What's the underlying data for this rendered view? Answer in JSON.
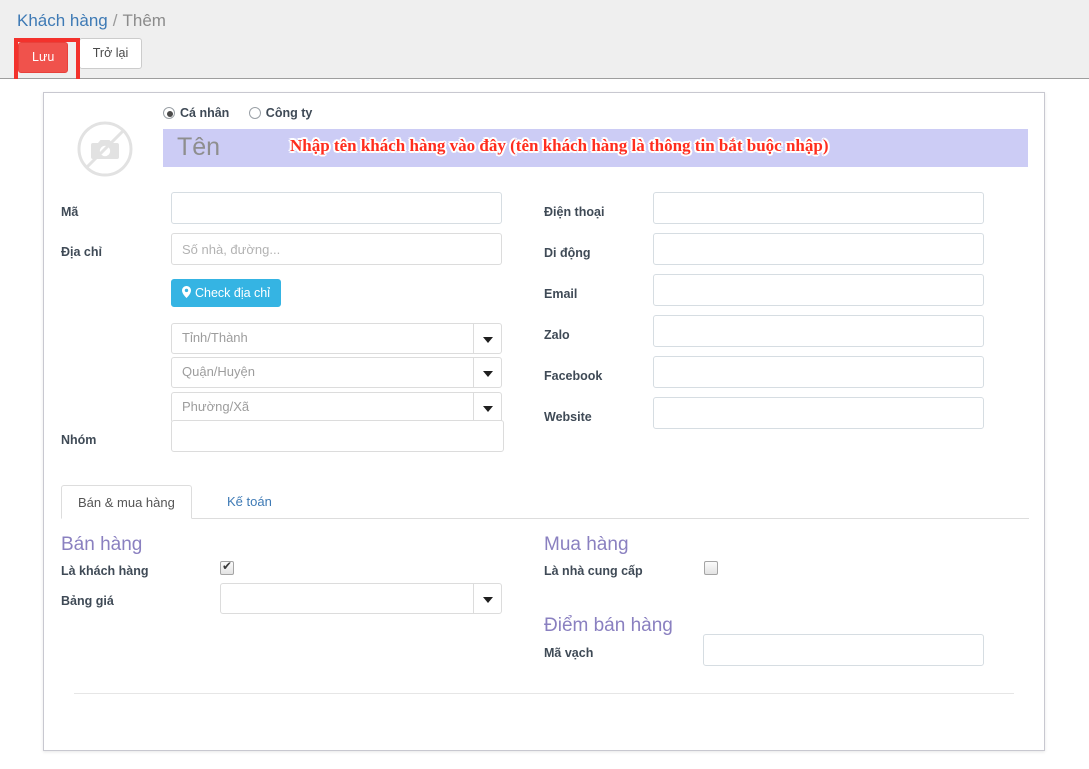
{
  "breadcrumb": {
    "parent": "Khách hàng",
    "separator": "/",
    "current": "Thêm"
  },
  "toolbar": {
    "save_label": "Lưu",
    "back_label": "Trở lại",
    "save_color": "#f0524c",
    "annotation_color": "#f3322c"
  },
  "avatar": {
    "icon": "no-camera-icon"
  },
  "customer_type": {
    "options": [
      {
        "label": "Cá nhân",
        "selected": true
      },
      {
        "label": "Công ty",
        "selected": false
      }
    ]
  },
  "name_field": {
    "placeholder": "Tên",
    "value": "",
    "highlight_color": "#ccccf5",
    "annotation": "Nhập tên khách hàng vào đây (tên khách hàng là thông tin bắt buộc nhập)",
    "annotation_color": "#ff2d1e"
  },
  "left_form": {
    "code": {
      "label": "Mã",
      "value": "",
      "placeholder": ""
    },
    "address": {
      "label": "Địa chỉ",
      "value": "",
      "placeholder": "Số nhà, đường..."
    },
    "check_address_button": {
      "label": "Check địa chỉ",
      "icon": "map-pin-icon",
      "color": "#35b4e3"
    },
    "province": {
      "label": "",
      "value": "Tỉnh/Thành"
    },
    "district": {
      "label": "",
      "value": "Quận/Huyện"
    },
    "ward": {
      "label": "",
      "value": "Phường/Xã"
    },
    "group": {
      "label": "Nhóm",
      "value": "",
      "placeholder": ""
    }
  },
  "right_form": {
    "phone": {
      "label": "Điện thoại",
      "value": ""
    },
    "mobile": {
      "label": "Di động",
      "value": ""
    },
    "email": {
      "label": "Email",
      "value": ""
    },
    "zalo": {
      "label": "Zalo",
      "value": ""
    },
    "facebook": {
      "label": "Facebook",
      "value": ""
    },
    "website": {
      "label": "Website",
      "value": ""
    }
  },
  "tabs": [
    {
      "label": "Bán & mua hàng",
      "active": true
    },
    {
      "label": "Kế toán",
      "active": false
    }
  ],
  "sell_section": {
    "title": "Bán hàng",
    "is_customer": {
      "label": "Là khách hàng",
      "checked": true
    },
    "price_list": {
      "label": "Bảng giá",
      "value": ""
    }
  },
  "buy_section": {
    "title": "Mua hàng",
    "is_supplier": {
      "label": "Là nhà cung cấp",
      "checked": false
    }
  },
  "pos_section": {
    "title": "Điểm bán hàng",
    "barcode": {
      "label": "Mã vạch",
      "value": ""
    }
  }
}
